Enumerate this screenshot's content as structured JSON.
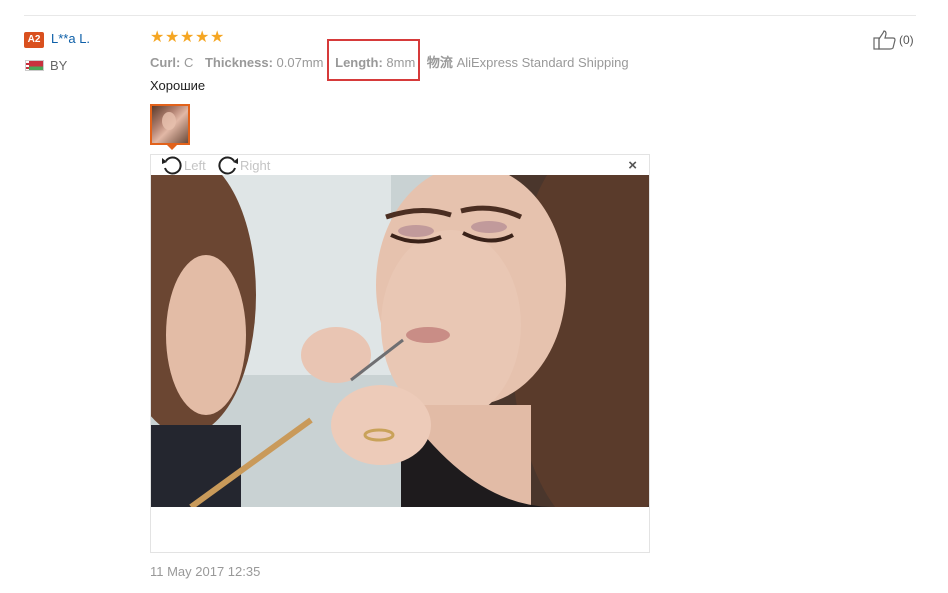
{
  "user": {
    "level_badge": "A2",
    "name": "L**a L.",
    "country_code": "BY"
  },
  "review": {
    "rating": 5,
    "stars": [
      "★",
      "★",
      "★",
      "★",
      "★"
    ],
    "attributes": [
      {
        "key": "Curl:",
        "value": "C"
      },
      {
        "key": "Thickness:",
        "value": "0.07mm"
      },
      {
        "key": "Length:",
        "value": "8mm"
      },
      {
        "key": "物流",
        "value": "AliExpress Standard Shipping"
      }
    ],
    "text": "Хорошие",
    "date": "11 May 2017 12:35"
  },
  "like": {
    "count": "(0)"
  },
  "viewer": {
    "rotate_left": "Left",
    "rotate_right": "Right",
    "close": "×"
  },
  "colors": {
    "accent": "#e2621b",
    "link": "#0d5fa8",
    "star": "#f5a623",
    "highlight_box": "#d63a3a"
  }
}
